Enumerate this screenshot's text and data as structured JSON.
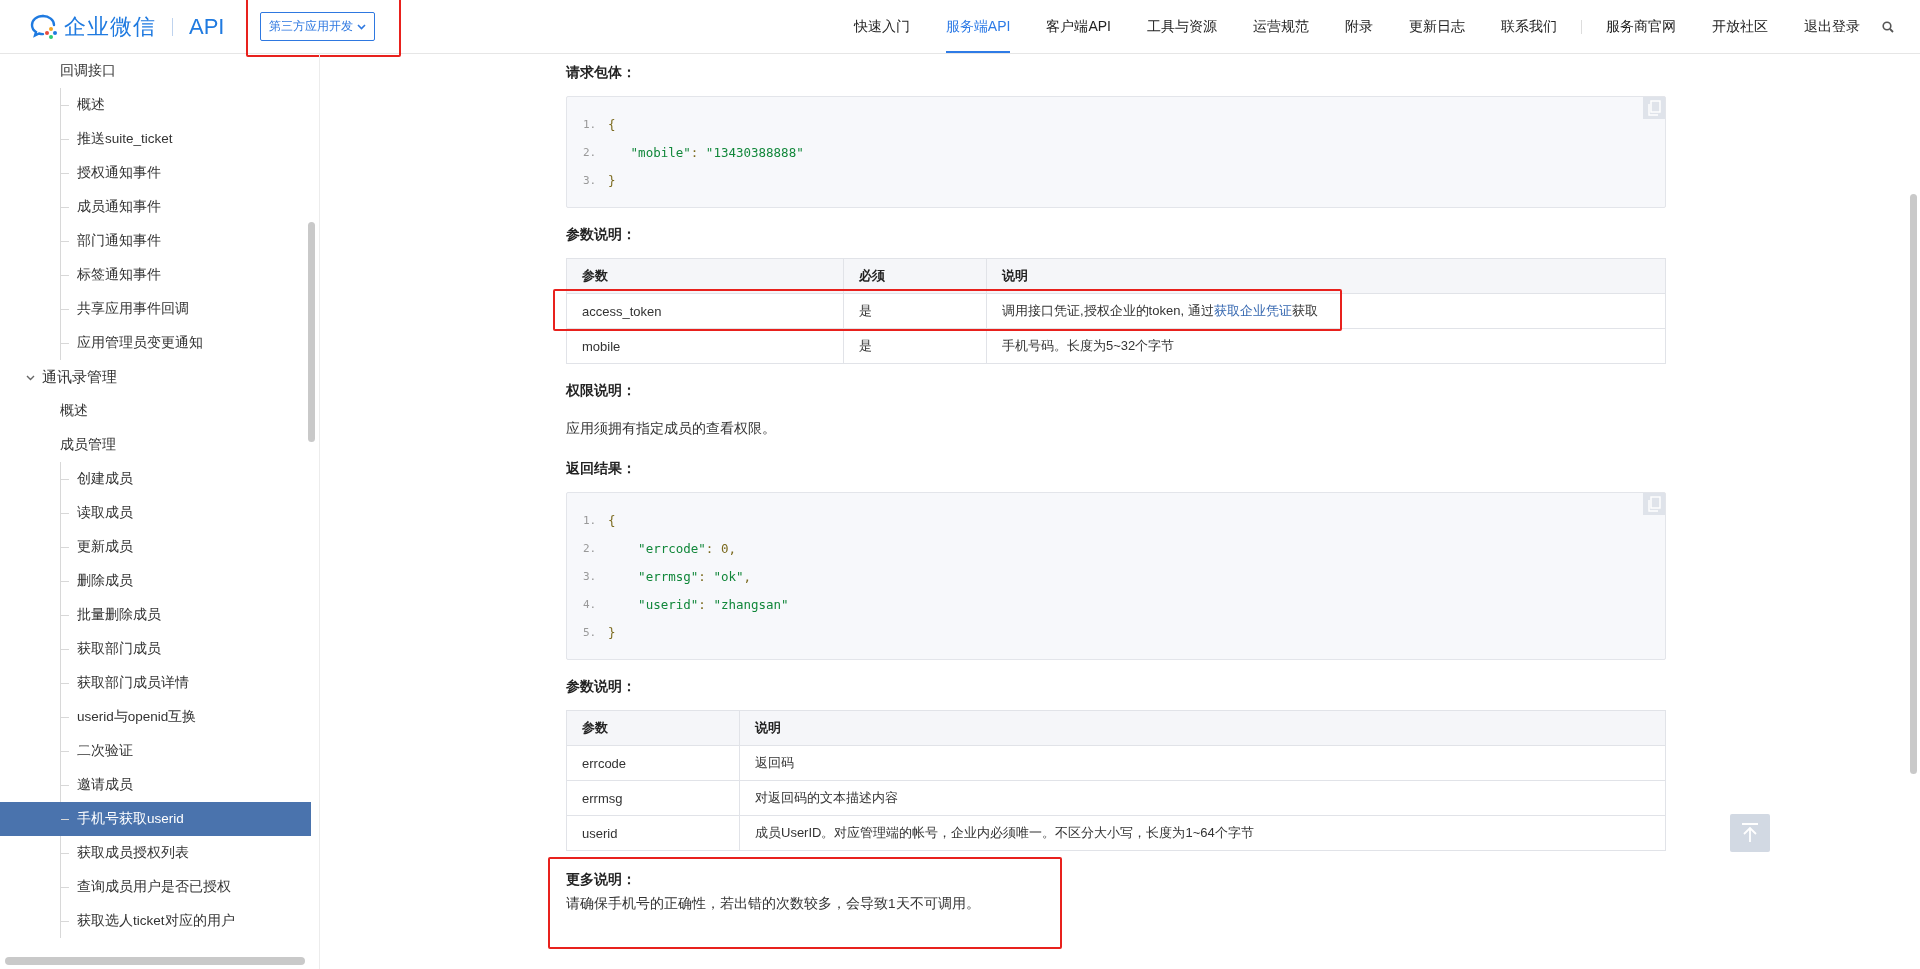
{
  "header": {
    "logo_text": "企业微信",
    "product": "API",
    "dropdown": {
      "label": "第三方应用开发",
      "highlighted": true
    },
    "nav": [
      {
        "label": "快速入门",
        "selected": false
      },
      {
        "label": "服务端API",
        "selected": true
      },
      {
        "label": "客户端API",
        "selected": false
      },
      {
        "label": "工具与资源",
        "selected": false
      },
      {
        "label": "运营规范",
        "selected": false
      },
      {
        "label": "附录",
        "selected": false
      },
      {
        "label": "更新日志",
        "selected": false
      },
      {
        "label": "联系我们",
        "selected": false
      }
    ],
    "extra_nav": [
      {
        "label": "服务商官网"
      },
      {
        "label": "开放社区"
      },
      {
        "label": "退出登录"
      }
    ]
  },
  "sidebar": {
    "items": [
      {
        "kind": "subsection",
        "label": "回调接口",
        "selected": false,
        "children": [
          {
            "label": "概述",
            "selected": false
          },
          {
            "label": "推送suite_ticket",
            "selected": false
          },
          {
            "label": "授权通知事件",
            "selected": false
          },
          {
            "label": "成员通知事件",
            "selected": false
          },
          {
            "label": "部门通知事件",
            "selected": false
          },
          {
            "label": "标签通知事件",
            "selected": false
          },
          {
            "label": "共享应用事件回调",
            "selected": false
          },
          {
            "label": "应用管理员变更通知",
            "selected": false
          }
        ]
      },
      {
        "kind": "category",
        "label": "通讯录管理",
        "selected": false,
        "expanded": true,
        "children": [
          {
            "label": "概述",
            "selected": false
          },
          {
            "label": "成员管理",
            "selected": false,
            "children": [
              {
                "label": "创建成员",
                "selected": false
              },
              {
                "label": "读取成员",
                "selected": false
              },
              {
                "label": "更新成员",
                "selected": false
              },
              {
                "label": "删除成员",
                "selected": false
              },
              {
                "label": "批量删除成员",
                "selected": false
              },
              {
                "label": "获取部门成员",
                "selected": false
              },
              {
                "label": "获取部门成员详情",
                "selected": false
              },
              {
                "label": "userid与openid互换",
                "selected": false
              },
              {
                "label": "二次验证",
                "selected": false
              },
              {
                "label": "邀请成员",
                "selected": false
              },
              {
                "label": "手机号获取userid",
                "selected": true
              },
              {
                "label": "获取成员授权列表",
                "selected": false
              },
              {
                "label": "查询成员用户是否已授权",
                "selected": false
              },
              {
                "label": "获取选人ticket对应的用户",
                "selected": false
              }
            ]
          }
        ]
      }
    ]
  },
  "content": [
    {
      "kind": "heading",
      "text": "请求包体："
    },
    {
      "kind": "code",
      "lines": [
        {
          "number": "1.",
          "code": "{"
        },
        {
          "number": "2.",
          "code": "   \"mobile\": \"13430388888\""
        },
        {
          "number": "3.",
          "code": "}"
        }
      ]
    },
    {
      "kind": "heading",
      "text": "参数说明："
    },
    {
      "kind": "table",
      "columns": [
        "参数",
        "必须",
        "说明"
      ],
      "rows": [
        {
          "highlighted": true,
          "cells": [
            "access_token",
            "是",
            {
              "text": "调用接口凭证,授权企业的token, 通过",
              "link": "获取企业凭证",
              "text_after": "获取"
            }
          ]
        },
        {
          "highlighted": false,
          "cells": [
            "mobile",
            "是",
            "手机号码。长度为5~32个字节"
          ]
        }
      ]
    },
    {
      "kind": "heading",
      "text": "权限说明："
    },
    {
      "kind": "paragraph",
      "text": "应用须拥有指定成员的查看权限。"
    },
    {
      "kind": "heading",
      "text": "返回结果："
    },
    {
      "kind": "code",
      "lines": [
        {
          "number": "1.",
          "code": "{"
        },
        {
          "number": "2.",
          "code": "    \"errcode\": 0,"
        },
        {
          "number": "3.",
          "code": "    \"errmsg\": \"ok\","
        },
        {
          "number": "4.",
          "code": "    \"userid\": \"zhangsan\""
        },
        {
          "number": "5.",
          "code": "}"
        }
      ]
    },
    {
      "kind": "heading",
      "text": "参数说明："
    },
    {
      "kind": "table",
      "columns": [
        "参数",
        "说明"
      ],
      "rows": [
        {
          "highlighted": false,
          "cells": [
            "errcode",
            "返回码"
          ]
        },
        {
          "highlighted": false,
          "cells": [
            "errmsg",
            "对返回码的文本描述内容"
          ]
        },
        {
          "highlighted": false,
          "cells": [
            "userid",
            "成员UserID。对应管理端的帐号，企业内必须唯一。不区分大小写，长度为1~64个字节"
          ]
        }
      ]
    },
    {
      "kind": "note",
      "title": "更多说明：",
      "text": "请确保手机号的正确性，若出错的次数较多，会导致1天不可调用。",
      "highlighted": true
    }
  ]
}
